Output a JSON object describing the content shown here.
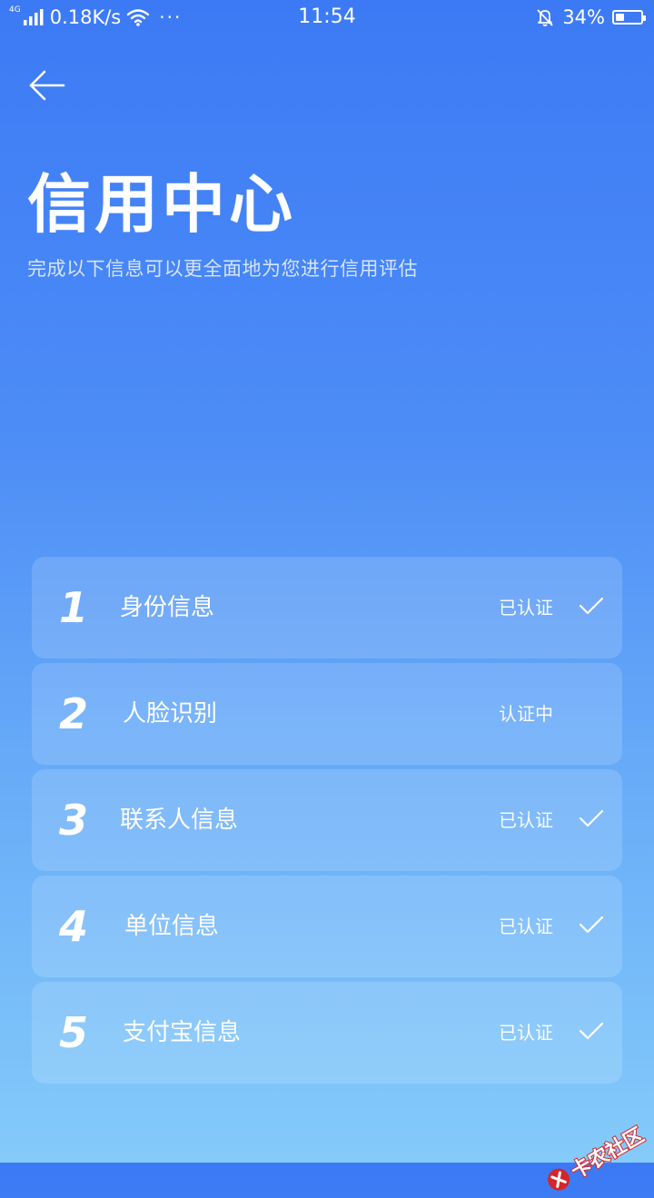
{
  "status_bar": {
    "network_type": "4G",
    "speed": "0.18K/s",
    "more": "···",
    "time": "11:54",
    "battery_percent": "34%",
    "battery_level": 0.34
  },
  "header": {
    "title": "信用中心",
    "subtitle": "完成以下信息可以更全面地为您进行信用评估"
  },
  "items": [
    {
      "number": "1",
      "label": "身份信息",
      "status": "已认证",
      "verified": true
    },
    {
      "number": "2",
      "label": "人脸识别",
      "status": "认证中",
      "verified": false
    },
    {
      "number": "3",
      "label": "联系人信息",
      "status": "已认证",
      "verified": true
    },
    {
      "number": "4",
      "label": "单位信息",
      "status": "已认证",
      "verified": true
    },
    {
      "number": "5",
      "label": "支付宝信息",
      "status": "已认证",
      "verified": true
    }
  ],
  "watermark": {
    "text": "卡农社区"
  },
  "colors": {
    "gradient_top": "#3c7af5",
    "gradient_bottom": "#84cbfa",
    "watermark_red": "#d6252b"
  }
}
